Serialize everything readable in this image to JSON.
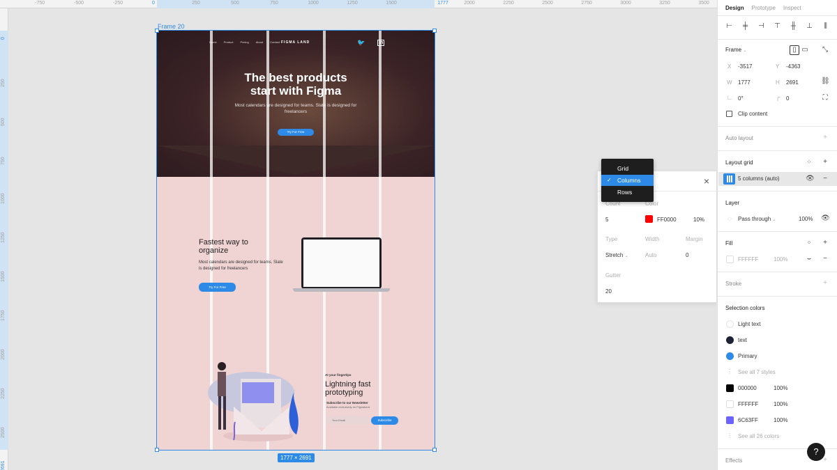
{
  "ruler": {
    "top_ticks": [
      "-750",
      "-500",
      "-250",
      "0",
      "250",
      "500",
      "750",
      "1000",
      "1250",
      "1500",
      "1777",
      "2000",
      "2250",
      "2500",
      "2750",
      "3000",
      "3250",
      "3500"
    ],
    "left_ticks": [
      "0",
      "250",
      "500",
      "750",
      "1000",
      "1250",
      "1500",
      "1750",
      "2000",
      "2250",
      "2500",
      "2691"
    ]
  },
  "canvas": {
    "frame_name": "Frame 20",
    "size_badge": "1777 × 2691"
  },
  "mockup": {
    "nav_items": [
      "Home",
      "Product",
      "Pricing",
      "About",
      "Contact"
    ],
    "logo": "FIGMA LAND",
    "hero_title_1": "The best products",
    "hero_title_2": "start with Figma",
    "hero_sub": "Most calendars are designed for teams. Slate is designed for freelancers",
    "hero_btn": "Try For Free",
    "s2_title_1": "Fastest way to",
    "s2_title_2": "organize",
    "s2_text": "Most calendars are designed for teams. Slate is designed for freelancers",
    "s2_btn": "Try For Free",
    "s3_kicker": "At your fingertips",
    "s3_title_1": "Lightning fast",
    "s3_title_2": "prototyping",
    "s3_sub": "Subscribe to our Newsletter",
    "s3_sub2": "Available exclusively on Figmaland",
    "email_placeholder": "Your Email",
    "subscribe_btn": "Subscribe"
  },
  "dropdown": {
    "options": [
      "Grid",
      "Columns",
      "Rows"
    ],
    "selected": "Columns"
  },
  "grid_settings": {
    "count_label": "Count",
    "count": "5",
    "color_label": "Color",
    "color_hex": "FF0000",
    "color_opacity": "10%",
    "type_label": "Type",
    "type": "Stretch",
    "width_label": "Width",
    "width": "Auto",
    "margin_label": "Margin",
    "margin": "0",
    "gutter_label": "Gutter",
    "gutter": "20"
  },
  "panel": {
    "tabs": [
      "Design",
      "Prototype",
      "Inspect"
    ],
    "frame_label": "Frame",
    "x_label": "X",
    "x": "-3517",
    "y_label": "Y",
    "y": "-4363",
    "w_label": "W",
    "w": "1777",
    "h_label": "H",
    "h": "2691",
    "rotation": "0°",
    "radius": "0",
    "clip_content": "Clip content",
    "auto_layout": "Auto layout",
    "layout_grid": "Layout grid",
    "grid_item": "5 columns (auto)",
    "layer": "Layer",
    "blend": "Pass through",
    "layer_opacity": "100%",
    "fill": "Fill",
    "fill_hex": "FFFFFF",
    "fill_opacity": "100%",
    "stroke": "Stroke",
    "selection_colors": "Selection colors",
    "styles": [
      "Light text",
      "text",
      "Primary"
    ],
    "see_all_styles": "See all 7 styles",
    "colors": [
      {
        "hex": "000000",
        "opacity": "100%"
      },
      {
        "hex": "FFFFFF",
        "opacity": "100%"
      },
      {
        "hex": "6C63FF",
        "opacity": "100%"
      }
    ],
    "see_all_colors": "See all 26 colors",
    "effects": "Effects"
  },
  "colors": {
    "accent": "#2d8ae6",
    "style_text": "#1e2235",
    "style_primary": "#2d8ae6",
    "swatch_black": "#000000",
    "swatch_white": "#ffffff",
    "swatch_purple": "#6C63FF",
    "grid_red": "#ff0000"
  },
  "help": "?"
}
